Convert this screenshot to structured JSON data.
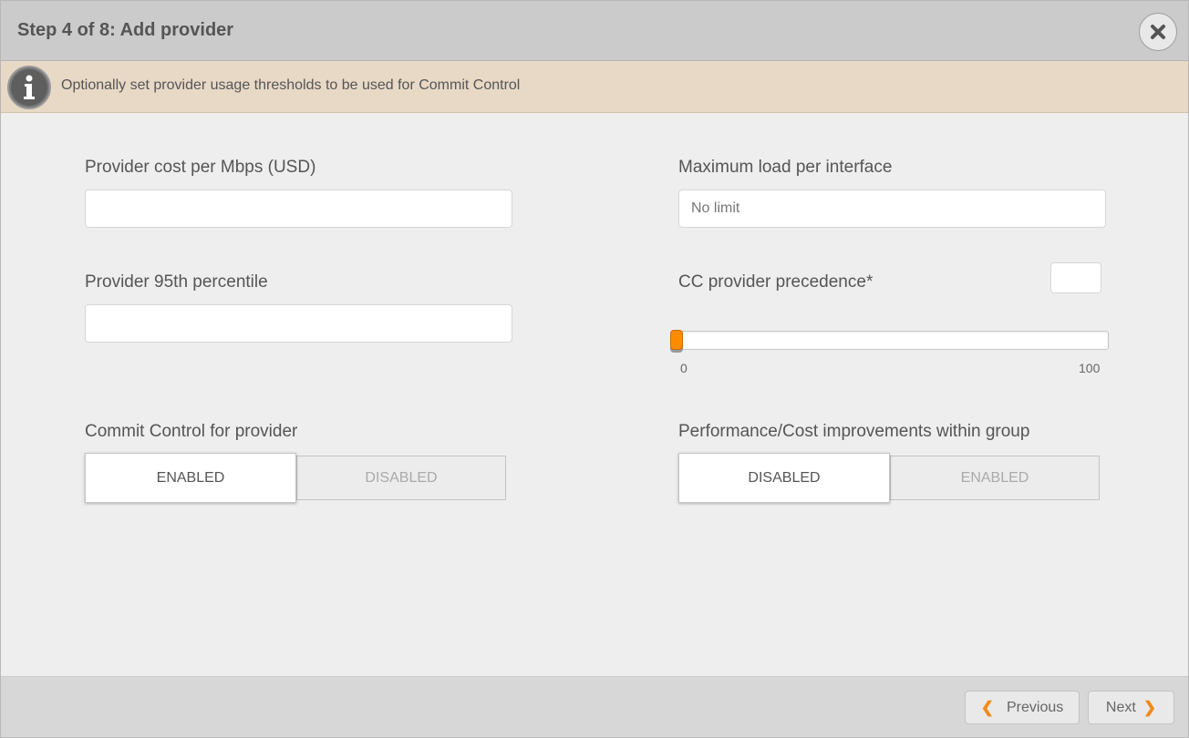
{
  "header": {
    "title": "Step 4 of 8: Add provider"
  },
  "info": {
    "text": "Optionally set provider usage thresholds to be used for Commit Control"
  },
  "fields": {
    "cost_label": "Provider cost per Mbps (USD)",
    "cost_value": "",
    "max_load_label": "Maximum load per interface",
    "max_load_placeholder": "No limit",
    "p95_label": "Provider 95th percentile",
    "p95_value": "",
    "precedence_label": "CC provider precedence*",
    "precedence_value": ""
  },
  "slider": {
    "min": 0,
    "max": 100,
    "value": 0,
    "min_label": "0",
    "max_label": "100"
  },
  "commit_control": {
    "label": "Commit Control for provider",
    "selected": "ENABLED",
    "other": "DISABLED"
  },
  "perf_cost": {
    "label": "Performance/Cost improvements within group",
    "selected": "DISABLED",
    "other": "ENABLED"
  },
  "footer": {
    "previous_label": "Previous",
    "next_label": "Next",
    "previous_icon": "chevron-left-icon",
    "next_icon": "chevron-right-icon"
  },
  "colors": {
    "accent": "#ff8c00",
    "header_bg": "#cbcbcb",
    "info_bg": "#e8d9c7",
    "body_bg": "#eeeeee",
    "footer_bg": "#d7d7d7"
  }
}
